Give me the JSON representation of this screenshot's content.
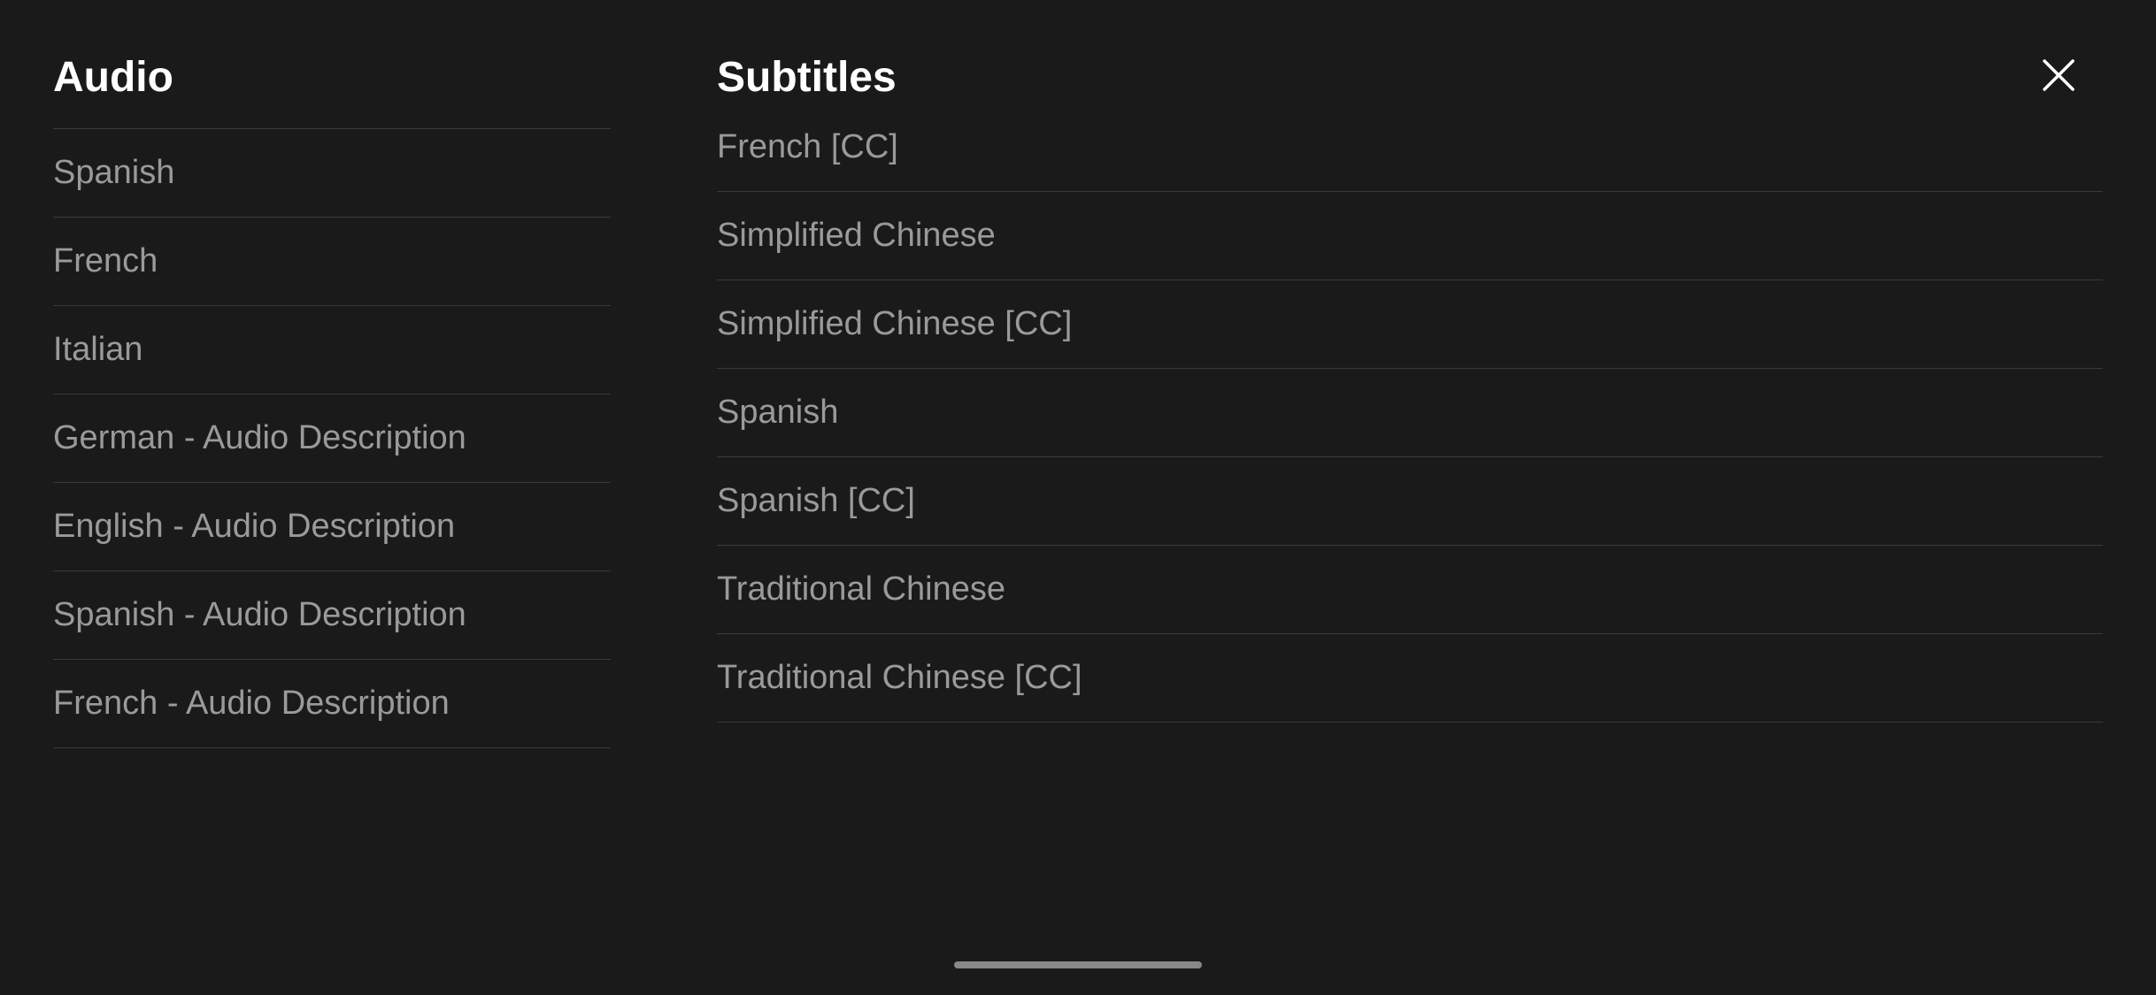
{
  "audio": {
    "title": "Audio",
    "items": [
      {
        "label": "Spanish"
      },
      {
        "label": "French"
      },
      {
        "label": "Italian"
      },
      {
        "label": "German - Audio Description"
      },
      {
        "label": "English - Audio Description"
      },
      {
        "label": "Spanish - Audio Description"
      },
      {
        "label": "French - Audio Description"
      }
    ]
  },
  "subtitles": {
    "title": "Subtitles",
    "items": [
      {
        "label": "French [CC]",
        "partial": true
      },
      {
        "label": "Simplified Chinese"
      },
      {
        "label": "Simplified Chinese  [CC]"
      },
      {
        "label": "Spanish"
      },
      {
        "label": "Spanish  [CC]"
      },
      {
        "label": "Traditional Chinese"
      },
      {
        "label": "Traditional Chinese  [CC]"
      }
    ]
  },
  "close": {
    "label": "×"
  },
  "scroll_indicator": {}
}
